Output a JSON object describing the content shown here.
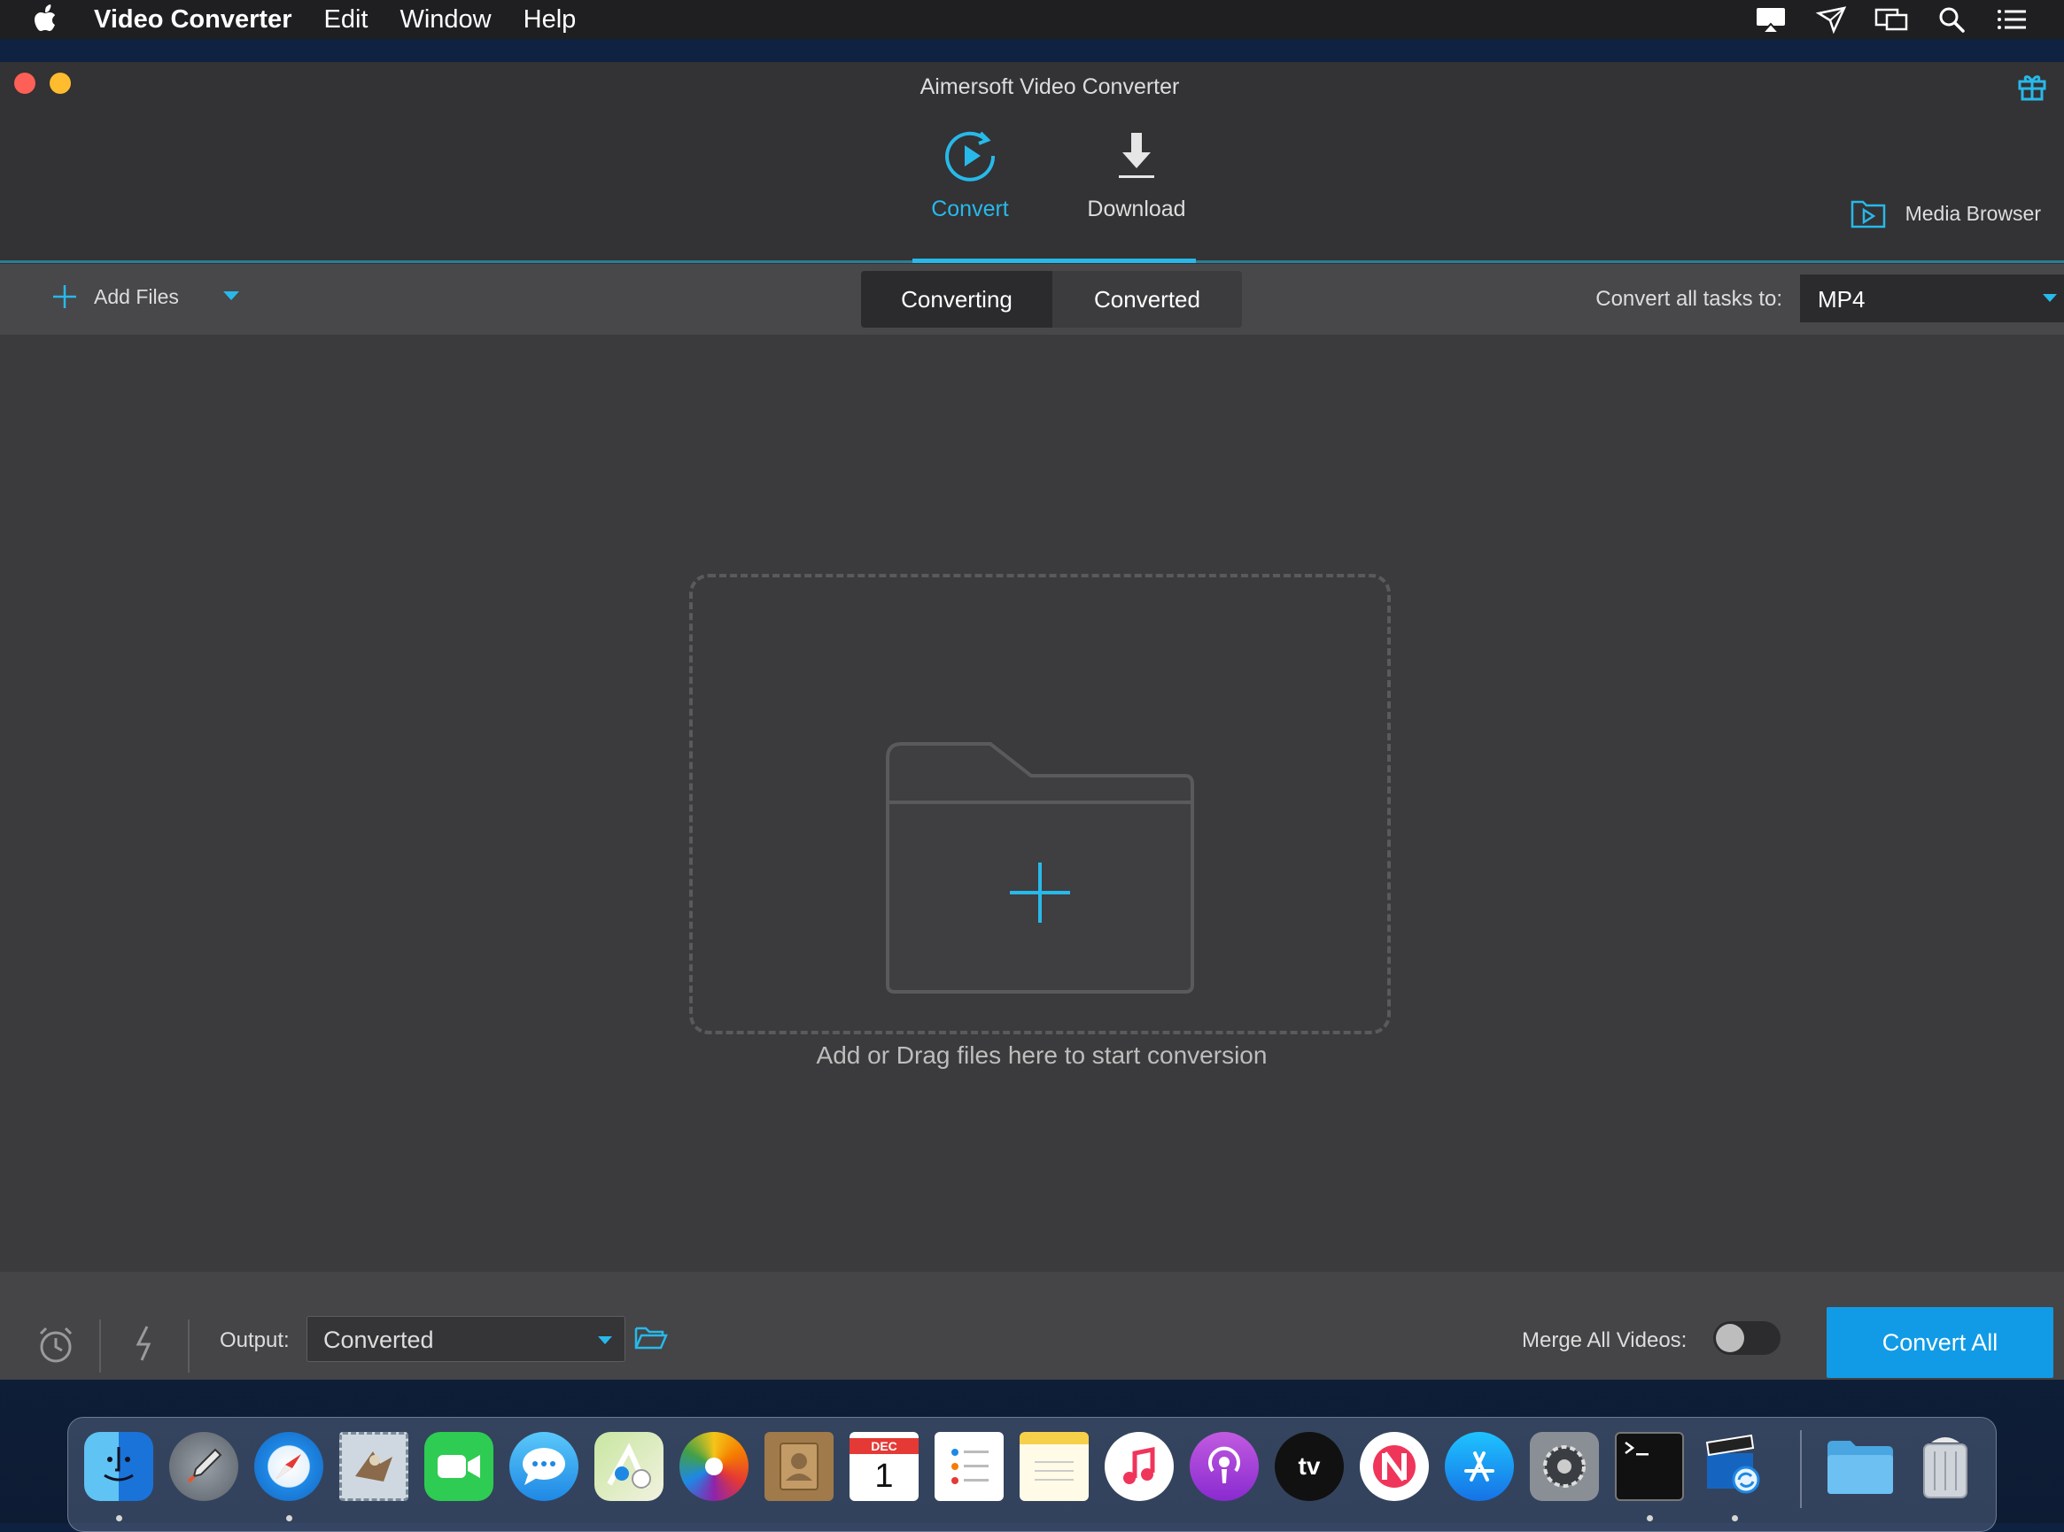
{
  "menubar": {
    "app_name": "Video Converter",
    "items": [
      "Edit",
      "Window",
      "Help"
    ]
  },
  "window": {
    "title": "Aimersoft Video Converter",
    "nav": [
      {
        "label": "Convert",
        "icon": "convert-icon",
        "active": true
      },
      {
        "label": "Download",
        "icon": "download-icon",
        "active": false
      }
    ],
    "media_browser_label": "Media Browser"
  },
  "toolbar": {
    "add_files_label": "Add Files",
    "tabs": [
      {
        "label": "Converting",
        "active": true
      },
      {
        "label": "Converted",
        "active": false
      }
    ],
    "convert_all_tasks_label": "Convert all tasks to:",
    "format_value": "MP4"
  },
  "dropzone": {
    "text": "Add or Drag files here to start conversion"
  },
  "bottombar": {
    "output_label": "Output:",
    "output_value": "Converted",
    "merge_label": "Merge All Videos:",
    "merge_enabled": false,
    "convert_all_label": "Convert All"
  },
  "dock": {
    "apps": [
      "finder",
      "launchpad",
      "safari",
      "mail",
      "facetime",
      "messages",
      "maps",
      "photos",
      "contacts",
      "calendar",
      "reminders",
      "notes",
      "music",
      "podcasts",
      "tv",
      "news",
      "app-store",
      "system-preferences",
      "terminal",
      "video-converter",
      "folder",
      "trash"
    ],
    "calendar_month": "DEC",
    "calendar_day": "1",
    "tv_label": "tv"
  },
  "colors": {
    "accent": "#27b9ea",
    "convert_button": "#119be6",
    "window_bg": "#3b3a3c"
  }
}
